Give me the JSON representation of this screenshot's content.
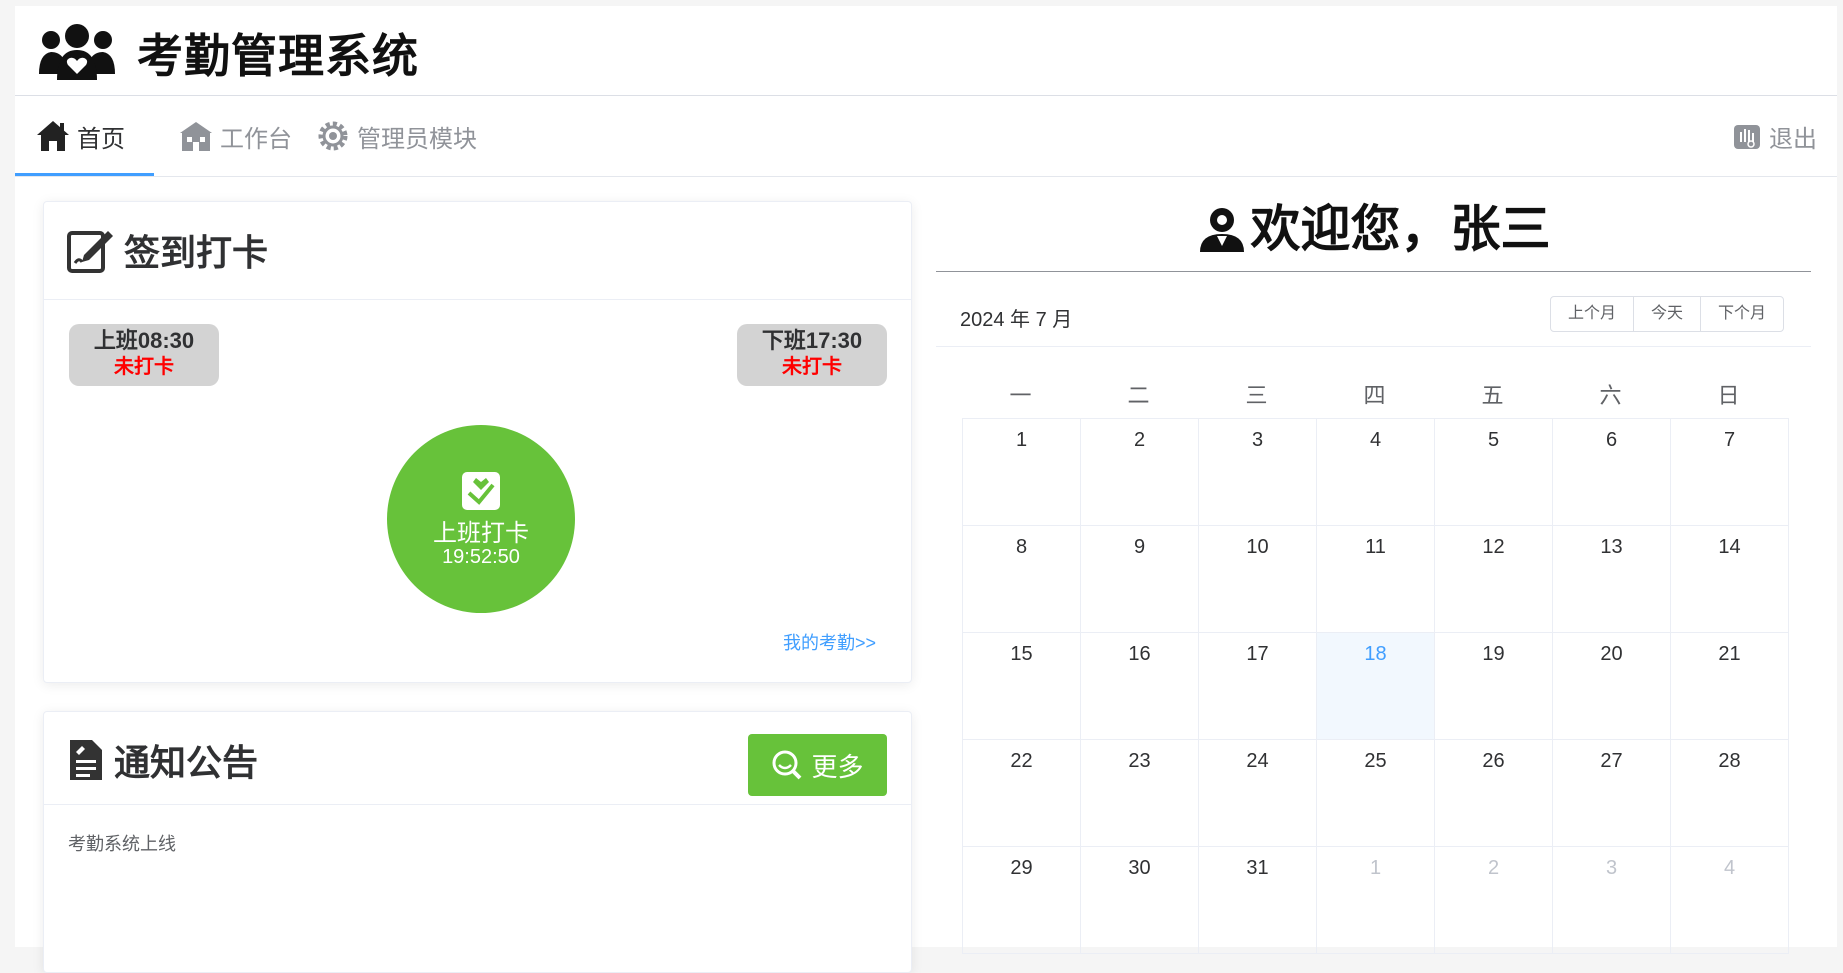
{
  "app": {
    "title": "考勤管理系统"
  },
  "nav": {
    "items": [
      {
        "label": "首页",
        "icon": "home-icon",
        "active": true
      },
      {
        "label": "工作台",
        "icon": "building-icon",
        "active": false
      },
      {
        "label": "管理员模块",
        "icon": "gear-icon",
        "active": false
      }
    ],
    "logout": {
      "label": "退出",
      "icon": "hand-icon"
    }
  },
  "checkin": {
    "title": "签到打卡",
    "on_duty": {
      "time": "上班08:30",
      "status": "未打卡"
    },
    "off_duty": {
      "time": "下班17:30",
      "status": "未打卡"
    },
    "punch": {
      "label": "上班打卡",
      "time": "19:52:50"
    },
    "my_attendance_link": "我的考勤>>"
  },
  "notice": {
    "title": "通知公告",
    "more_label": "更多",
    "items": [
      "考勤系统上线"
    ]
  },
  "welcome": {
    "text": "欢迎您，张三"
  },
  "calendar": {
    "month_label": "2024 年 7 月",
    "buttons": {
      "prev": "上个月",
      "today": "今天",
      "next": "下个月"
    },
    "weekdays": [
      "一",
      "二",
      "三",
      "四",
      "五",
      "六",
      "日"
    ],
    "weeks": [
      [
        "1",
        "2",
        "3",
        "4",
        "5",
        "6",
        "7"
      ],
      [
        "8",
        "9",
        "10",
        "11",
        "12",
        "13",
        "14"
      ],
      [
        "15",
        "16",
        "17",
        "18",
        "19",
        "20",
        "21"
      ],
      [
        "22",
        "23",
        "24",
        "25",
        "26",
        "27",
        "28"
      ],
      [
        "29",
        "30",
        "31",
        "1",
        "2",
        "3",
        "4"
      ]
    ],
    "today": "18",
    "colors": {
      "accent": "#409eff",
      "green": "#67c23a",
      "alert": "#ff0000"
    }
  }
}
